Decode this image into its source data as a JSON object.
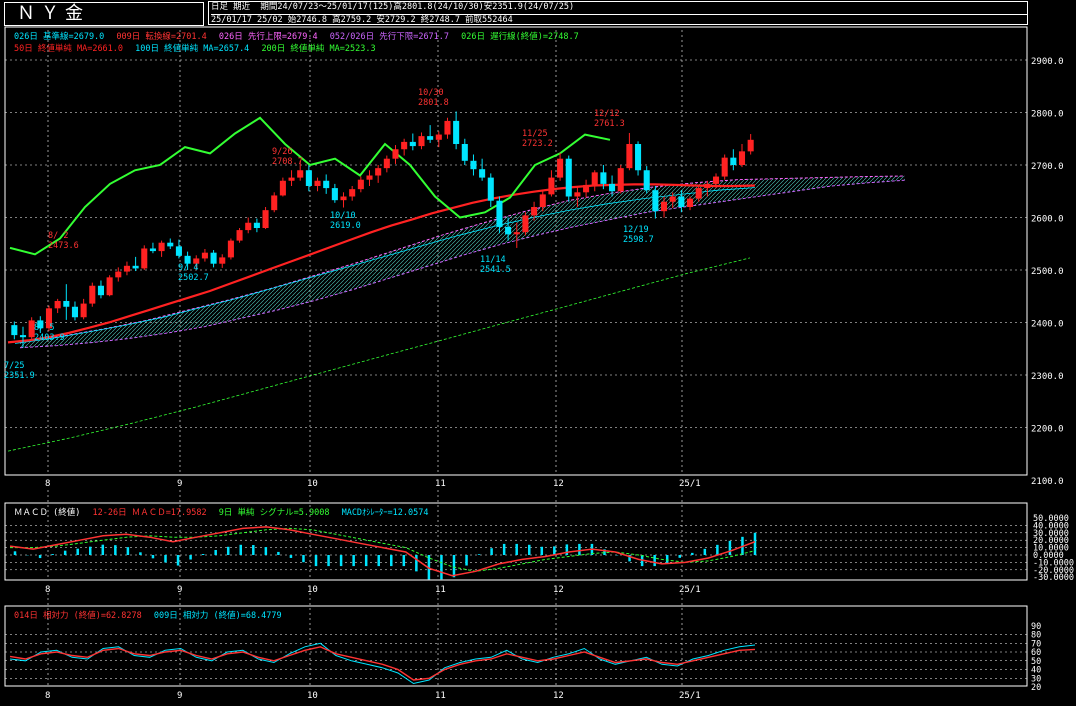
{
  "header": {
    "title": "ＮＹ金",
    "mode": "日足 期近",
    "period_info": "期間24/07/23～25/01/17(125)高2801.8(24/10/30)安2351.9(24/07/25)",
    "quote_info": "25/01/17 25/02 始2746.8 高2759.2 安2729.2 終2748.7 前取552464"
  },
  "legend_main_1": [
    {
      "text": "026日 基準線=2679.0",
      "color": "#00e5ff"
    },
    {
      "text": "009日 転換線=2701.4",
      "color": "#ff3333"
    },
    {
      "text": "026日 先行上限=2679.4",
      "color": "#ff66ff"
    },
    {
      "text": "052/026日 先行下限=2671.7",
      "color": "#cc66ff"
    },
    {
      "text": "026日 遅行線(終値)=2748.7",
      "color": "#33ff33"
    }
  ],
  "legend_main_2": [
    {
      "text": "50日 終値単純 MA=2661.0",
      "color": "#ff2222"
    },
    {
      "text": "100日 終値単純 MA=2657.4",
      "color": "#00e5ff"
    },
    {
      "text": "200日 終値単純 MA=2523.3",
      "color": "#33ff33"
    }
  ],
  "legend_macd": [
    {
      "text": "ＭＡＣＤ (終値)",
      "color": "#ffffff"
    },
    {
      "text": "12-26日 ＭＡＣＤ=17.9582",
      "color": "#ff3333"
    },
    {
      "text": "9日 単純 シグナル=5.9008",
      "color": "#33ff33"
    },
    {
      "text": "MACDｵｼﾚｰﾀｰ=12.0574",
      "color": "#00e5ff"
    }
  ],
  "legend_rsi": [
    {
      "text": "014日 相対力 (終値)=62.8278",
      "color": "#ff3333"
    },
    {
      "text": "009日 相対力 (終値)=68.4779",
      "color": "#00e5ff"
    }
  ],
  "x_axis_labels": [
    "8",
    "9",
    "10",
    "11",
    "12",
    "25/1"
  ],
  "price_axis": [
    "2900.0",
    "2800.0",
    "2700.0",
    "2600.0",
    "2500.0",
    "2400.0",
    "2300.0",
    "2200.0",
    "2100.0"
  ],
  "macd_axis": [
    "50.0000",
    "40.0000",
    "30.0000",
    "20.0000",
    "10.0000",
    "0.0000",
    "-10.0000",
    "-20.0000",
    "-30.0000"
  ],
  "rsi_axis": [
    "90",
    "80",
    "70",
    "60",
    "50",
    "40",
    "30",
    "20"
  ],
  "annotations": [
    {
      "date": "7/25",
      "price": "2351.9",
      "color": "#00e5ff"
    },
    {
      "date": "8/ 5",
      "price": "2403.9",
      "color": "#00e5ff"
    },
    {
      "date": "8/ 2",
      "price": "2473.6",
      "color": "#ff3333"
    },
    {
      "date": "9/ 4",
      "price": "2502.7",
      "color": "#00e5ff"
    },
    {
      "date": "9/26",
      "price": "2708.7",
      "color": "#ff3333"
    },
    {
      "date": "10/10",
      "price": "2619.0",
      "color": "#00e5ff"
    },
    {
      "date": "10/30",
      "price": "2801.8",
      "color": "#ff3333"
    },
    {
      "date": "11/14",
      "price": "2541.5",
      "color": "#00e5ff"
    },
    {
      "date": "11/25",
      "price": "2723.2",
      "color": "#ff3333"
    },
    {
      "date": "12/12",
      "price": "2761.3",
      "color": "#ff3333"
    },
    {
      "date": "12/19",
      "price": "2598.7",
      "color": "#00e5ff"
    }
  ],
  "chart_data": {
    "type": "candlestick",
    "x_labels": [
      "8",
      "9",
      "10",
      "11",
      "12",
      "25/1"
    ],
    "price_ylim": [
      2100,
      2940
    ],
    "candles": [
      [
        2395,
        2402,
        2368,
        2376
      ],
      [
        2376,
        2392,
        2352,
        2372
      ],
      [
        2372,
        2410,
        2366,
        2404
      ],
      [
        2404,
        2412,
        2380,
        2389
      ],
      [
        2389,
        2432,
        2384,
        2427
      ],
      [
        2427,
        2445,
        2418,
        2441
      ],
      [
        2441,
        2473,
        2405,
        2430
      ],
      [
        2430,
        2440,
        2404,
        2410
      ],
      [
        2410,
        2445,
        2406,
        2436
      ],
      [
        2436,
        2476,
        2430,
        2470
      ],
      [
        2470,
        2480,
        2446,
        2452
      ],
      [
        2452,
        2490,
        2450,
        2486
      ],
      [
        2486,
        2505,
        2478,
        2497
      ],
      [
        2497,
        2516,
        2490,
        2508
      ],
      [
        2508,
        2525,
        2498,
        2503
      ],
      [
        2503,
        2547,
        2500,
        2541
      ],
      [
        2541,
        2552,
        2532,
        2536
      ],
      [
        2536,
        2556,
        2525,
        2552
      ],
      [
        2552,
        2560,
        2540,
        2545
      ],
      [
        2545,
        2558,
        2522,
        2527
      ],
      [
        2527,
        2535,
        2500,
        2512
      ],
      [
        2512,
        2528,
        2502,
        2522
      ],
      [
        2522,
        2540,
        2516,
        2533
      ],
      [
        2533,
        2538,
        2505,
        2512
      ],
      [
        2512,
        2530,
        2504,
        2524
      ],
      [
        2524,
        2560,
        2520,
        2556
      ],
      [
        2556,
        2580,
        2552,
        2576
      ],
      [
        2576,
        2600,
        2570,
        2590
      ],
      [
        2590,
        2598,
        2572,
        2580
      ],
      [
        2580,
        2620,
        2578,
        2614
      ],
      [
        2614,
        2648,
        2610,
        2642
      ],
      [
        2642,
        2676,
        2640,
        2670
      ],
      [
        2670,
        2690,
        2660,
        2676
      ],
      [
        2676,
        2708,
        2670,
        2690
      ],
      [
        2690,
        2700,
        2650,
        2660
      ],
      [
        2660,
        2676,
        2650,
        2670
      ],
      [
        2670,
        2682,
        2645,
        2656
      ],
      [
        2656,
        2664,
        2628,
        2633
      ],
      [
        2633,
        2648,
        2619,
        2640
      ],
      [
        2640,
        2660,
        2632,
        2654
      ],
      [
        2654,
        2678,
        2648,
        2672
      ],
      [
        2672,
        2690,
        2660,
        2680
      ],
      [
        2680,
        2700,
        2666,
        2694
      ],
      [
        2694,
        2718,
        2686,
        2712
      ],
      [
        2712,
        2738,
        2702,
        2730
      ],
      [
        2730,
        2750,
        2718,
        2744
      ],
      [
        2744,
        2760,
        2728,
        2736
      ],
      [
        2736,
        2762,
        2730,
        2755
      ],
      [
        2755,
        2776,
        2742,
        2748
      ],
      [
        2748,
        2764,
        2734,
        2758
      ],
      [
        2758,
        2790,
        2750,
        2784
      ],
      [
        2784,
        2802,
        2730,
        2740
      ],
      [
        2740,
        2750,
        2700,
        2708
      ],
      [
        2708,
        2720,
        2680,
        2692
      ],
      [
        2692,
        2712,
        2670,
        2676
      ],
      [
        2676,
        2684,
        2620,
        2632
      ],
      [
        2632,
        2640,
        2570,
        2582
      ],
      [
        2582,
        2600,
        2556,
        2568
      ],
      [
        2568,
        2590,
        2542,
        2572
      ],
      [
        2572,
        2610,
        2566,
        2604
      ],
      [
        2604,
        2630,
        2594,
        2620
      ],
      [
        2620,
        2650,
        2612,
        2644
      ],
      [
        2644,
        2690,
        2640,
        2676
      ],
      [
        2676,
        2723,
        2670,
        2712
      ],
      [
        2712,
        2718,
        2630,
        2640
      ],
      [
        2640,
        2660,
        2620,
        2648
      ],
      [
        2648,
        2672,
        2638,
        2662
      ],
      [
        2662,
        2690,
        2650,
        2686
      ],
      [
        2686,
        2700,
        2654,
        2664
      ],
      [
        2664,
        2680,
        2640,
        2650
      ],
      [
        2650,
        2700,
        2646,
        2694
      ],
      [
        2694,
        2761,
        2690,
        2740
      ],
      [
        2740,
        2745,
        2680,
        2690
      ],
      [
        2690,
        2698,
        2646,
        2652
      ],
      [
        2652,
        2660,
        2598,
        2612
      ],
      [
        2612,
        2640,
        2600,
        2630
      ],
      [
        2630,
        2648,
        2618,
        2640
      ],
      [
        2640,
        2652,
        2610,
        2620
      ],
      [
        2620,
        2640,
        2614,
        2636
      ],
      [
        2636,
        2662,
        2630,
        2656
      ],
      [
        2656,
        2670,
        2640,
        2664
      ],
      [
        2664,
        2684,
        2656,
        2678
      ],
      [
        2678,
        2720,
        2672,
        2714
      ],
      [
        2714,
        2730,
        2690,
        2700
      ],
      [
        2700,
        2740,
        2696,
        2726
      ],
      [
        2726,
        2759,
        2720,
        2748
      ]
    ],
    "ma50": [
      2362,
      2366,
      2372,
      2380,
      2390,
      2400,
      2412,
      2424,
      2436,
      2448,
      2460,
      2474,
      2488,
      2502,
      2516,
      2530,
      2544,
      2558,
      2572,
      2585,
      2596,
      2608,
      2618,
      2628,
      2636,
      2643,
      2649,
      2654,
      2658,
      2661,
      2662,
      2663,
      2663,
      2662,
      2661,
      2660,
      2660,
      2661
    ],
    "ma100": [
      2360,
      2370,
      2382,
      2395,
      2410,
      2428,
      2446,
      2466,
      2486,
      2506,
      2526,
      2546,
      2566,
      2584,
      2600,
      2614,
      2626,
      2636,
      2644,
      2652,
      2657
    ],
    "ma200": [
      2155,
      2180,
      2208,
      2238,
      2270,
      2302,
      2334,
      2366,
      2398,
      2430,
      2462,
      2494,
      2523
    ],
    "span_a": [
      2362,
      2374,
      2388,
      2404,
      2424,
      2444,
      2466,
      2490,
      2514,
      2540,
      2566,
      2590,
      2612,
      2632,
      2646,
      2658,
      2666,
      2672,
      2674,
      2676,
      2678,
      2679
    ],
    "span_b": [
      2352,
      2356,
      2362,
      2370,
      2380,
      2392,
      2408,
      2424,
      2442,
      2462,
      2484,
      2506,
      2528,
      2548,
      2566,
      2582,
      2596,
      2610,
      2620,
      2630,
      2640,
      2650,
      2660,
      2666,
      2671
    ],
    "lagging": [
      2542,
      2530,
      2560,
      2620,
      2664,
      2690,
      2700,
      2734,
      2722,
      2760,
      2790,
      2740,
      2700,
      2712,
      2680,
      2740,
      2700,
      2640,
      2600,
      2610,
      2638,
      2700,
      2722,
      2758,
      2748
    ],
    "macd_ylim": [
      -35,
      55
    ],
    "macd": [
      12,
      8,
      14,
      20,
      26,
      28,
      24,
      18,
      24,
      30,
      36,
      38,
      34,
      28,
      22,
      16,
      10,
      4,
      -18,
      -28,
      -22,
      -12,
      -6,
      -2,
      4,
      8,
      4,
      -6,
      -12,
      -10,
      -4,
      6,
      18
    ],
    "macd_signal": [
      10,
      10,
      12,
      16,
      20,
      24,
      26,
      24,
      24,
      26,
      30,
      34,
      36,
      34,
      28,
      22,
      16,
      10,
      -4,
      -16,
      -22,
      -18,
      -12,
      -6,
      -2,
      2,
      4,
      0,
      -6,
      -10,
      -8,
      -2,
      6
    ],
    "rsi_ylim": [
      18,
      92
    ],
    "rsi14": [
      55,
      52,
      58,
      60,
      56,
      54,
      62,
      64,
      58,
      56,
      60,
      62,
      56,
      52,
      58,
      60,
      54,
      50,
      56,
      62,
      66,
      58,
      54,
      50,
      46,
      40,
      28,
      30,
      40,
      46,
      50,
      52,
      58,
      54,
      50,
      52,
      56,
      60,
      54,
      48,
      50,
      52,
      48,
      46,
      50,
      54,
      58,
      62,
      63
    ],
    "rsi9": [
      52,
      50,
      60,
      62,
      54,
      52,
      64,
      66,
      56,
      54,
      62,
      64,
      54,
      50,
      60,
      62,
      52,
      48,
      58,
      66,
      70,
      56,
      50,
      46,
      42,
      36,
      24,
      28,
      42,
      48,
      52,
      54,
      62,
      52,
      48,
      54,
      58,
      64,
      52,
      46,
      50,
      54,
      46,
      44,
      52,
      56,
      62,
      66,
      68
    ]
  }
}
